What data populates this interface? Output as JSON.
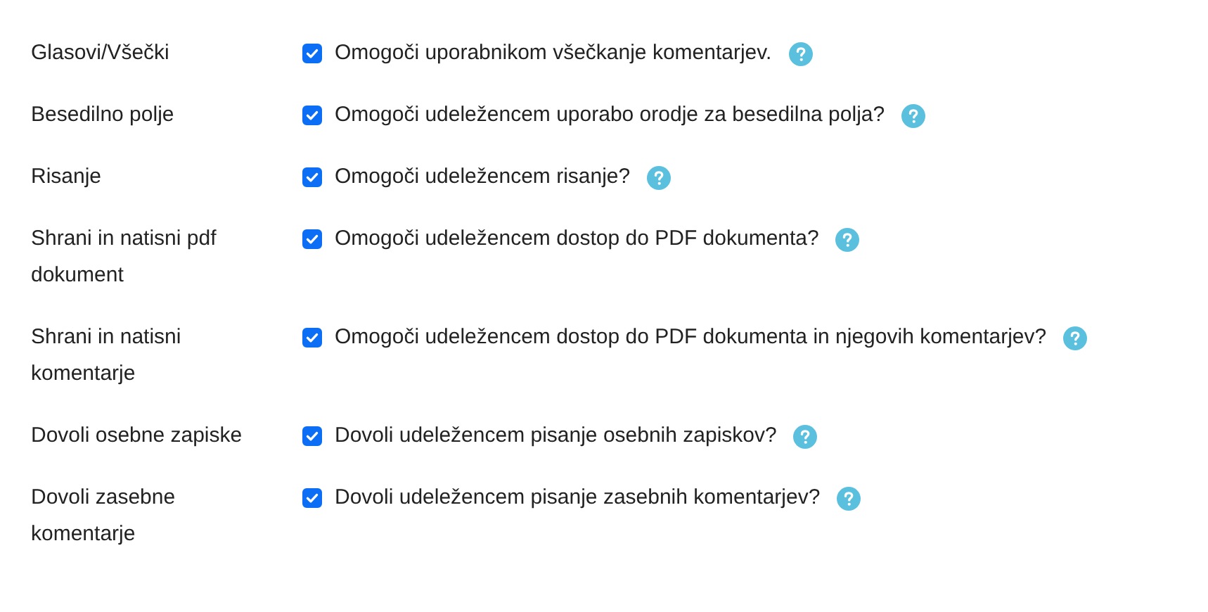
{
  "settings": [
    {
      "label": "Glasovi/Všečki",
      "checked": true,
      "description": "Omogoči uporabnikom všečkanje komentarjev."
    },
    {
      "label": "Besedilno polje",
      "checked": true,
      "description": "Omogoči udeležencem uporabo orodje za besedilna polja?"
    },
    {
      "label": "Risanje",
      "checked": true,
      "description": "Omogoči udeležencem risanje?"
    },
    {
      "label": "Shrani in natisni pdf dokument",
      "checked": true,
      "description": "Omogoči udeležencem dostop do PDF dokumenta?"
    },
    {
      "label": "Shrani in natisni komentarje",
      "checked": true,
      "description": "Omogoči udeležencem dostop do PDF dokumenta in njegovih komentarjev?"
    },
    {
      "label": "Dovoli osebne zapiske",
      "checked": true,
      "description": "Dovoli udeležencem pisanje osebnih zapiskov?"
    },
    {
      "label": "Dovoli zasebne komentarje",
      "checked": true,
      "description": "Dovoli udeležencem pisanje zasebnih komentarjev?"
    }
  ]
}
